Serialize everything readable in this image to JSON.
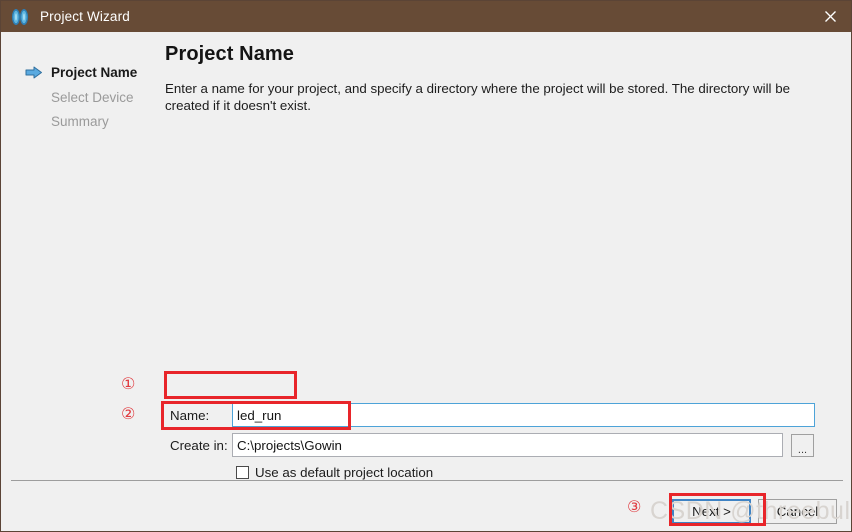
{
  "window": {
    "title": "Project Wizard",
    "logo_icon": "gowin-diamond-logo-icon",
    "close_icon": "close-icon",
    "titlebar_color": "#674b36",
    "background_color": "#f0f0f0"
  },
  "sidebar": {
    "items": [
      {
        "label": "Project Name",
        "state": "active",
        "icon": "arrow-right-icon"
      },
      {
        "label": "Select Device",
        "state": "inactive"
      },
      {
        "label": "Summary",
        "state": "inactive"
      }
    ]
  },
  "main": {
    "title": "Project Name",
    "description": "Enter a name for your project, and specify a directory where the project will be stored. The directory will be created if it doesn't exist."
  },
  "form": {
    "name": {
      "label": "Name:",
      "value": "led_run",
      "placeholder": "",
      "focused": true,
      "focus_border_color": "#4da3d8"
    },
    "location": {
      "label": "Create in:",
      "value": "C:\\projects\\Gowin",
      "placeholder": "",
      "browse_label": "...",
      "browse_icon": "ellipsis-icon"
    },
    "default_location": {
      "label": "Use as default project location",
      "checked": false
    }
  },
  "footer": {
    "next_label": "Next >",
    "cancel_label": "Cancel",
    "next_focused": true,
    "focus_border_color": "#3f83c4"
  },
  "annotations": {
    "color": "#e8252a",
    "markers": [
      {
        "id": "1",
        "glyph": "①",
        "target": "name-field"
      },
      {
        "id": "2",
        "glyph": "②",
        "target": "create-in-field"
      },
      {
        "id": "3",
        "glyph": "③",
        "target": "next-button"
      }
    ]
  },
  "watermark": {
    "text": "CSDN @threebullets"
  }
}
